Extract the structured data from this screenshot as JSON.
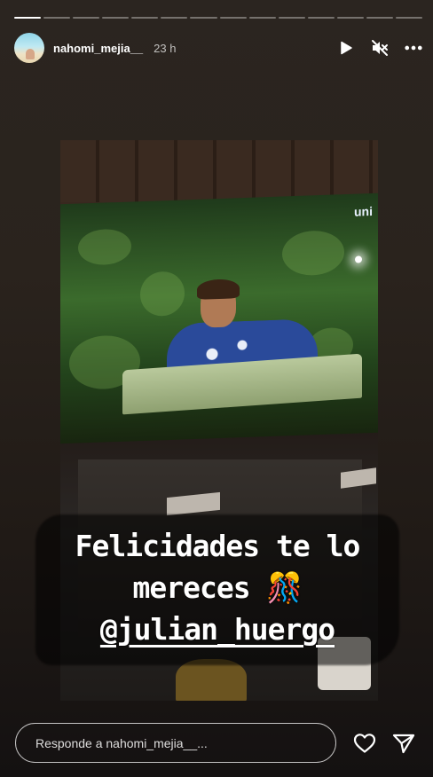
{
  "story": {
    "segments_total": 14,
    "active_segment": 1
  },
  "header": {
    "username": "nahomi_mejia__",
    "time": "23 h",
    "icons": [
      "play-icon",
      "muted-icon",
      "more-icon"
    ]
  },
  "media": {
    "tv_logo": "uni"
  },
  "caption": {
    "line1": "Felicidades te lo",
    "line2": "mereces 🎊",
    "line3": "@julian_huergo"
  },
  "footer": {
    "reply_placeholder": "Responde a nahomi_mejia__...",
    "icons": [
      "heart-icon",
      "send-icon"
    ]
  },
  "colors": {
    "text": "#ffffff",
    "background": "#241e19"
  }
}
